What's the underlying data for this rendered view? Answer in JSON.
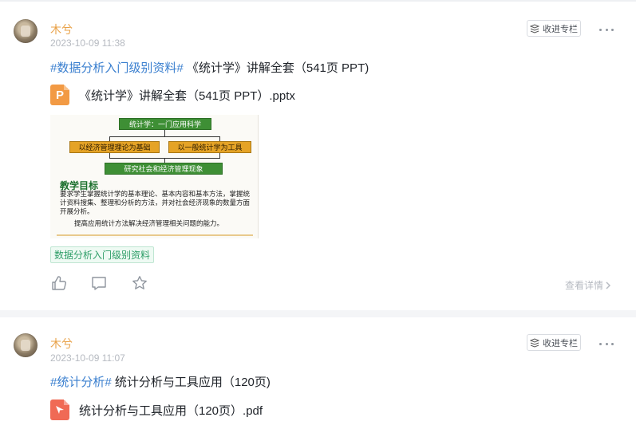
{
  "posts": [
    {
      "author": "木兮",
      "time": "2023-10-09 11:38",
      "collect_label": "收进专栏",
      "hashtag": "#数据分析入门级别资料#",
      "title": "《统计学》讲解全套（541页 PPT)",
      "file": {
        "type": "pptx",
        "icon_letter": "P",
        "name": "《统计学》讲解全套（541页 PPT）.pptx"
      },
      "preview": {
        "top_box": "统计学：一门应用科学",
        "left_box": "以经济管理理论为基础",
        "right_box": "以一般统计学为工具",
        "bottom_box": "研究社会和经济管理现象",
        "heading": "教学目标",
        "body": "要求学生掌握统计学的基本理论、基本内容和基本方法，掌握统计资料搜集、整理和分析的方法，并对社会经济现象的数量方面开展分析。",
        "body2": "提高应用统计方法解决经济管理相关问题的能力。"
      },
      "tag": "数据分析入门级别资料",
      "view_detail": "查看详情"
    },
    {
      "author": "木兮",
      "time": "2023-10-09 11:07",
      "collect_label": "收进专栏",
      "hashtag": "#统计分析#",
      "title": "统计分析与工具应用（120页)",
      "file": {
        "type": "pdf",
        "name": "统计分析与工具应用（120页）.pdf"
      }
    }
  ],
  "colors": {
    "author": "#e8a046",
    "hashtag": "#3a7fcf",
    "tag": "#2f9e68",
    "ppt": "#f29a44",
    "pdf": "#f06a55"
  },
  "icons": [
    "like-icon",
    "comment-icon",
    "star-icon",
    "chevron-right-icon",
    "more-icon",
    "collect-icon"
  ]
}
